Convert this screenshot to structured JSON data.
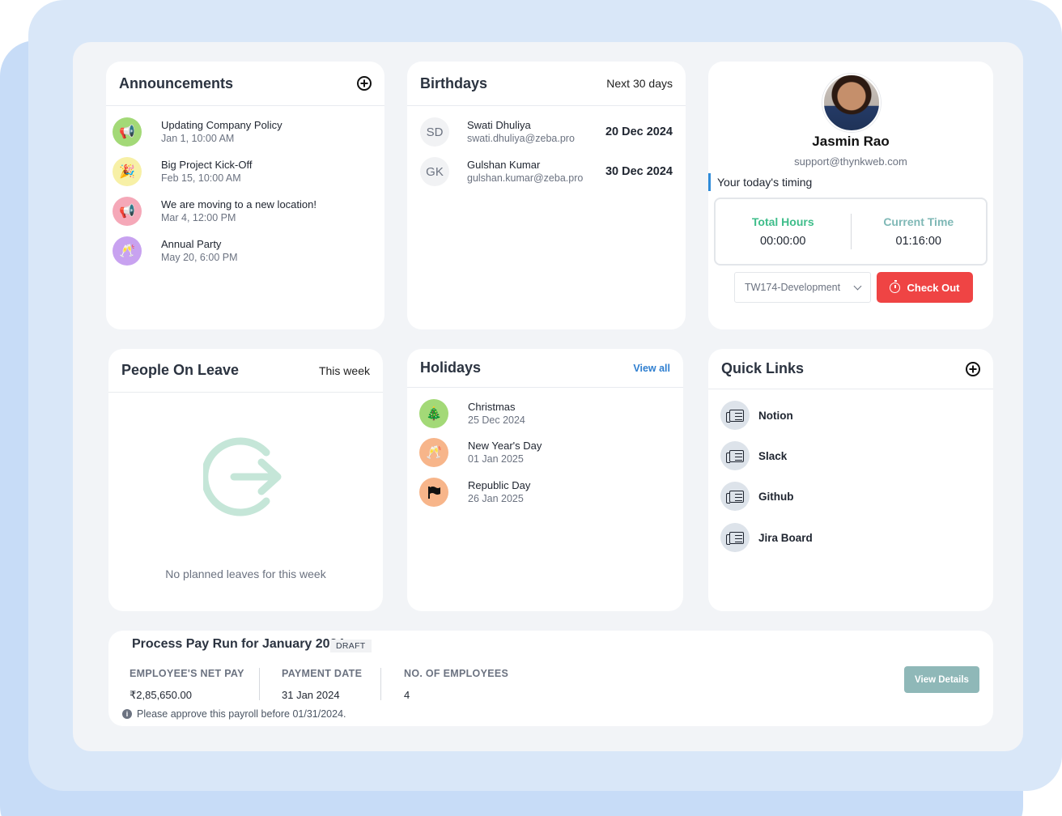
{
  "announcements": {
    "title": "Announcements",
    "items": [
      {
        "title": "Updating Company Policy",
        "date": "Jan 1, 10:00 AM",
        "icon": "megaphone-icon",
        "color": "#a3d977"
      },
      {
        "title": "Big Project Kick-Off",
        "date": "Feb 15, 10:00 AM",
        "icon": "party-popper-icon",
        "color": "#f7f0a6"
      },
      {
        "title": "We are moving to a new location!",
        "date": "Mar 4, 12:00 PM",
        "icon": "megaphone-icon",
        "color": "#f5a8b8"
      },
      {
        "title": "Annual Party",
        "date": "May 20, 6:00 PM",
        "icon": "cheers-icon",
        "color": "#c8a2f0"
      }
    ]
  },
  "birthdays": {
    "title": "Birthdays",
    "range": "Next 30 days",
    "items": [
      {
        "initials": "SD",
        "name": "Swati Dhuliya",
        "email": "swati.dhuliya@zeba.pro",
        "date": "20 Dec 2024"
      },
      {
        "initials": "GK",
        "name": "Gulshan Kumar",
        "email": "gulshan.kumar@zeba.pro",
        "date": "30 Dec 2024"
      }
    ]
  },
  "profile": {
    "name": "Jasmin Rao",
    "email": "support@thynkweb.com",
    "timing_label": "Your today's timing",
    "total_hours_label": "Total Hours",
    "total_hours": "00:00:00",
    "current_time_label": "Current Time",
    "current_time": "01:16:00",
    "project": "TW174-Development",
    "checkout_label": "Check Out",
    "colors": {
      "total": "#3ebd8a",
      "current": "#7fb8b6",
      "checkout": "#ef4444"
    }
  },
  "leave": {
    "title": "People On Leave",
    "range": "This week",
    "empty_text": "No planned leaves for this week",
    "icon": "leave-exit-icon"
  },
  "holidays": {
    "title": "Holidays",
    "view_all": "View all",
    "items": [
      {
        "name": "Christmas",
        "date": "25 Dec 2024",
        "icon": "tree-icon",
        "color": "#a3d977"
      },
      {
        "name": "New Year's Day",
        "date": "01 Jan 2025",
        "icon": "cheers-icon",
        "color": "#f7b58a"
      },
      {
        "name": "Republic Day",
        "date": "26 Jan 2025",
        "icon": "flag-icon",
        "color": "#f7b58a"
      }
    ]
  },
  "quick_links": {
    "title": "Quick Links",
    "items": [
      {
        "label": "Notion",
        "icon": "newspaper-icon"
      },
      {
        "label": "Slack",
        "icon": "newspaper-icon"
      },
      {
        "label": "Github",
        "icon": "newspaper-icon"
      },
      {
        "label": "Jira Board",
        "icon": "newspaper-icon"
      }
    ]
  },
  "payrun": {
    "title": "Process Pay Run for January 2024",
    "status": "DRAFT",
    "net_pay_label": "EMPLOYEE'S NET PAY",
    "net_pay": "₹2,85,650.00",
    "payment_date_label": "PAYMENT DATE",
    "payment_date": "31 Jan 2024",
    "employees_label": "NO. OF EMPLOYEES",
    "employees": "4",
    "note": "Please approve this payroll before 01/31/2024.",
    "view_details": "View Details"
  }
}
